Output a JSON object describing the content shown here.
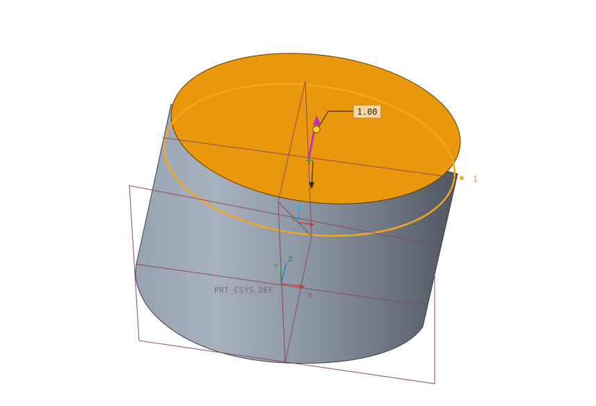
{
  "viewport": {
    "csys_label": "PRT_CSYS_DEF",
    "dimension_value": "1.00",
    "plane_tag": "1",
    "axis_labels": {
      "x": "X",
      "y": "Y",
      "z": "Z",
      "x2": "X",
      "y2": "Y",
      "z2": "Z"
    }
  },
  "colors": {
    "background": "#ffffff",
    "highlight_face": "#e8980a",
    "highlight_edge": "#f4a81c",
    "body_dark": "#5a626d",
    "body_light": "#a6b0bd",
    "datum_plane": "#8a4a5c",
    "drag_handle": "#c030c0"
  }
}
